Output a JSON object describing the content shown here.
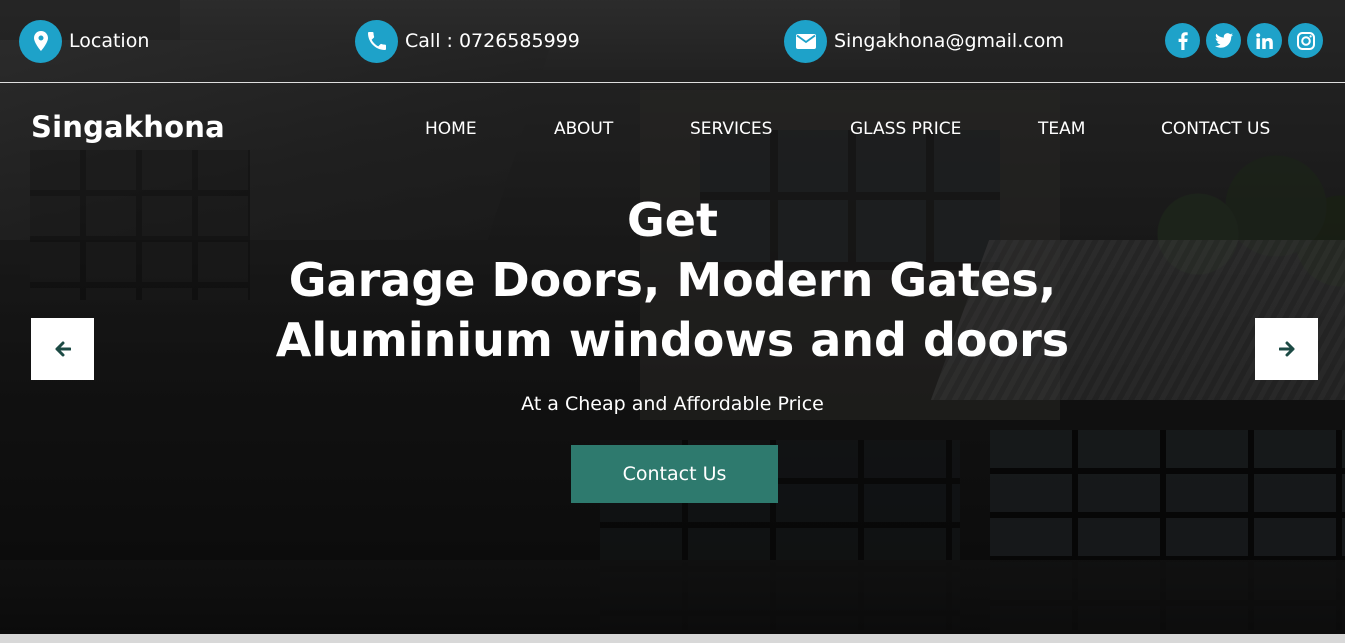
{
  "topbar": {
    "location": {
      "icon": "map-marker-icon",
      "text": "Location"
    },
    "phone": {
      "icon": "phone-icon",
      "text": "Call : 0726585999"
    },
    "email": {
      "icon": "envelope-icon",
      "text": "Singakhona@gmail.com"
    },
    "socials": [
      {
        "icon": "facebook-icon",
        "glyph": "f"
      },
      {
        "icon": "twitter-icon",
        "glyph": "t"
      },
      {
        "icon": "linkedin-icon",
        "glyph": "in"
      },
      {
        "icon": "instagram-icon",
        "glyph": ""
      }
    ]
  },
  "brand": "Singakhona",
  "nav": {
    "items": [
      {
        "label": "HOME"
      },
      {
        "label": "ABOUT"
      },
      {
        "label": "SERVICES"
      },
      {
        "label": "GLASS PRICE"
      },
      {
        "label": "TEAM"
      },
      {
        "label": "CONTACT US"
      }
    ]
  },
  "hero": {
    "line1": "Get",
    "line2": "Garage Doors, Modern Gates,",
    "line3": "Aluminium windows and doors",
    "subtitle": "At a Cheap and Affordable Price",
    "cta_label": "Contact Us"
  },
  "carousel": {
    "prev_icon": "arrow-left-icon",
    "next_icon": "arrow-right-icon"
  },
  "colors": {
    "accent": "#1ea2c9",
    "cta": "#2e7a6e",
    "arrow": "#1c4a44"
  }
}
